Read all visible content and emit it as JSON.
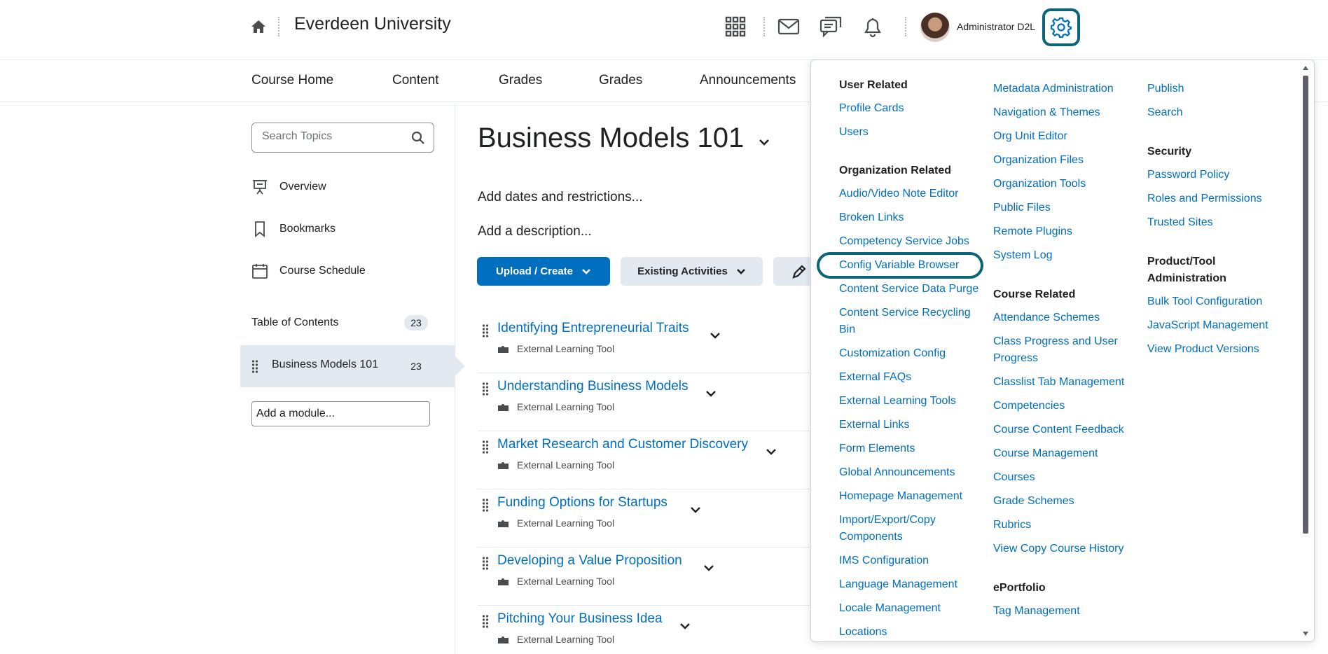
{
  "header": {
    "org_name": "Everdeen University",
    "user_name": "Administrator D2L",
    "icons": [
      "home-icon",
      "grid-icon",
      "mail-icon",
      "chat-icon",
      "bell-icon",
      "gear-icon"
    ]
  },
  "nav": {
    "items": [
      "Course Home",
      "Content",
      "Grades",
      "Grades",
      "Announcements"
    ]
  },
  "sidebar": {
    "search_placeholder": "Search Topics",
    "links": [
      "Overview",
      "Bookmarks",
      "Course Schedule"
    ],
    "toc_label": "Table of Contents",
    "toc_count": "23",
    "module_name": "Business Models 101",
    "module_count": "23",
    "add_module": "Add a module..."
  },
  "main": {
    "title": "Business Models 101",
    "add_dates": "Add dates and restrictions...",
    "add_description": "Add a description...",
    "upload_create": "Upload / Create",
    "existing_activities": "Existing Activities",
    "topics": [
      {
        "name": "Identifying Entrepreneurial Traits",
        "type": "External Learning Tool"
      },
      {
        "name": "Understanding Business Models",
        "type": "External Learning Tool"
      },
      {
        "name": "Market Research and Customer Discovery",
        "type": "External Learning Tool"
      },
      {
        "name": "Funding Options for Startups",
        "type": "External Learning Tool"
      },
      {
        "name": "Developing a Value Proposition",
        "type": "External Learning Tool"
      },
      {
        "name": "Pitching Your Business Idea",
        "type": "External Learning Tool"
      }
    ]
  },
  "dropdown": {
    "col1": {
      "user_related": "User Related",
      "user_links": [
        "Profile Cards",
        "Users"
      ],
      "org_related": "Organization Related",
      "org_links": [
        "Audio/Video Note Editor",
        "Broken Links",
        "Competency Service Jobs",
        "Config Variable Browser",
        "Content Service Data Purge",
        "Content Service Recycling",
        "Bin",
        "Customization Config",
        "External FAQs",
        "External Learning Tools",
        "External Links",
        "Form Elements",
        "Global Announcements",
        "Homepage Management",
        "Import/Export/Copy",
        "Components",
        "IMS Configuration",
        "Language Management",
        "Locale Management",
        "Locations"
      ]
    },
    "col2": {
      "org_links": [
        "Metadata Administration",
        "Navigation & Themes",
        "Org Unit Editor",
        "Organization Files",
        "Organization Tools",
        "Public Files",
        "Remote Plugins",
        "System Log"
      ],
      "course_related": "Course Related",
      "course_links": [
        "Attendance Schemes",
        "Class Progress and User",
        "Progress",
        "Classlist Tab Management",
        "Competencies",
        "Course Content Feedback",
        "Course Management",
        "Courses",
        "Grade Schemes",
        "Rubrics",
        "View Copy Course History"
      ],
      "eportfolio": "ePortfolio",
      "eportfolio_links": [
        "Tag Management"
      ]
    },
    "col3": {
      "top_links": [
        "Publish",
        "Search"
      ],
      "security": "Security",
      "security_links": [
        "Password Policy",
        "Roles and Permissions",
        "Trusted Sites"
      ],
      "product_admin_1": "Product/Tool",
      "product_admin_2": "Administration",
      "product_links": [
        "Bulk Tool Configuration",
        "JavaScript Management",
        "View Product Versions"
      ]
    }
  }
}
